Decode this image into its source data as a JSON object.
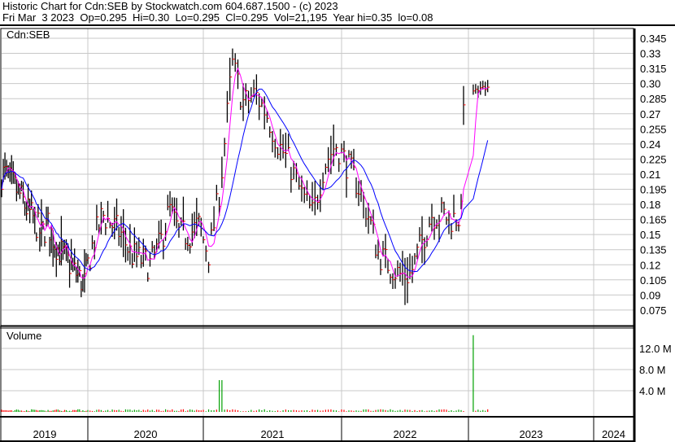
{
  "header": {
    "title": "Historic Chart for Cdn:SEB by Stockwatch.com 604.687.1500 - (c) 2023",
    "quote": "Fri Mar  3 2023  Op=0.295  Hi=0.30  Lo=0.295  Cl=0.295  Vol=21,195  Year hi=0.35  lo=0.08"
  },
  "chart_data": {
    "type": "bar",
    "title": "Cdn:SEB",
    "volume_label": "Volume",
    "price_ticks": [
      "0.345",
      "0.33",
      "0.315",
      "0.30",
      "0.285",
      "0.27",
      "0.255",
      "0.24",
      "0.225",
      "0.21",
      "0.195",
      "0.18",
      "0.165",
      "0.15",
      "0.135",
      "0.12",
      "0.105",
      "0.09",
      "0.075"
    ],
    "price_range": [
      0.063,
      0.355
    ],
    "volume_ticks": [
      "12.0 M",
      "8.0 M",
      "4.0 M"
    ],
    "volume_range_millions": [
      0,
      16.5
    ],
    "year_labels": [
      "2019",
      "2020",
      "2021",
      "2022",
      "2023",
      "2024"
    ],
    "monthly_close": {
      "2019": [
        0.21,
        0.2,
        0.19,
        0.175,
        0.165,
        0.15,
        0.16,
        0.14,
        0.13,
        0.12,
        0.11,
        0.1
      ],
      "2020": [
        0.14,
        0.17,
        0.16,
        0.15,
        0.13,
        0.125,
        0.12,
        0.14,
        0.175,
        0.15,
        0.15,
        0.16
      ],
      "2021": [
        0.13,
        0.2,
        0.32,
        0.28,
        0.29,
        0.27,
        0.24,
        0.22,
        0.19,
        0.17,
        0.22,
        0.24
      ],
      "2022": [
        0.22,
        0.2,
        0.17,
        0.13,
        0.12,
        0.11,
        0.11,
        0.14,
        0.17,
        0.17,
        0.165,
        0.17
      ],
      "2023": [
        0.29,
        0.295,
        0.295
      ]
    },
    "volume_spikes_millions": [
      {
        "date": "2021-02",
        "value": 6.0
      },
      {
        "date": "2023-01",
        "value": 14.5
      }
    ],
    "series": [
      {
        "name": "short moving average",
        "color": "#ff00ff"
      },
      {
        "name": "long moving average",
        "color": "#0000ff"
      }
    ],
    "colors": {
      "bars": "#000000",
      "close_tick": "#ff0000",
      "volume_up": "#00a000",
      "volume_down": "#ff0000"
    }
  }
}
